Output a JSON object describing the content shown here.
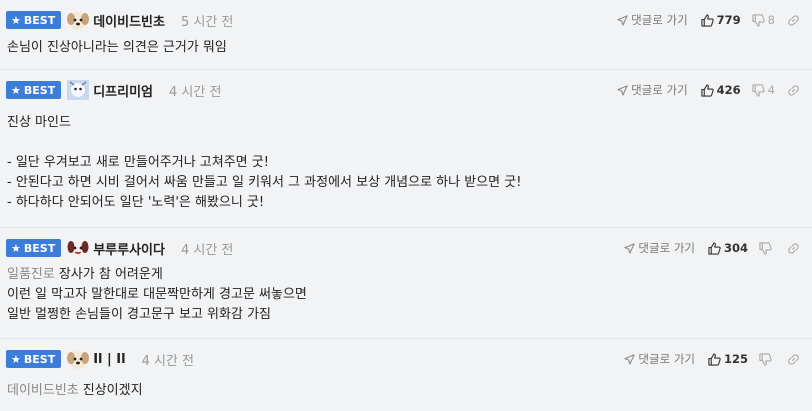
{
  "comments": [
    {
      "badge": "BEST",
      "nickname": "데이비드빈초",
      "time": "5 시간 전",
      "reply_label": "댓글로 가기",
      "upvotes": "779",
      "downvotes": "8",
      "lines": [
        "손님이 진상아니라는 의견은 근거가 뭐임"
      ]
    },
    {
      "badge": "BEST",
      "nickname": "디프리미엄",
      "time": "4 시간 전",
      "reply_label": "댓글로 가기",
      "upvotes": "426",
      "downvotes": "4",
      "lines": [
        "진상 마인드",
        "",
        "- 일단 우겨보고 새로 만들어주거나 고쳐주면 굿!",
        "- 안된다고 하면 시비 걸어서 싸움 만들고 일 키워서 그 과정에서 보상 개념으로 하나 받으면 굿!",
        "- 하다하다 안되어도 일단 '노력'은 해봤으니 굿!"
      ]
    },
    {
      "badge": "BEST",
      "nickname": "부루루사이다",
      "time": "4 시간 전",
      "reply_label": "댓글로 가기",
      "upvotes": "304",
      "downvotes": "",
      "ref_user": "일품진로",
      "lines": [
        "장사가 참 어려운게",
        "이런 일 막고자 말한대로 대문짝만하게 경고문 써놓으면",
        "일반 멀쩡한 손님들이 경고문구 보고 위화감 가짐"
      ]
    },
    {
      "badge": "BEST",
      "nickname": "Il | Il",
      "time": "4 시간 전",
      "reply_label": "댓글로 가기",
      "upvotes": "125",
      "downvotes": "",
      "ref_user": "데이비드빈초",
      "lines": [
        "진상이겠지"
      ]
    }
  ],
  "colors": {
    "badge": "#3b7dd8",
    "background": "#f2f3f5"
  },
  "icons": [
    "star-icon",
    "avatar-puppy",
    "avatar-snow",
    "avatar-red",
    "send-arrow-icon",
    "thumbs-up-icon",
    "thumbs-down-icon",
    "link-icon"
  ]
}
